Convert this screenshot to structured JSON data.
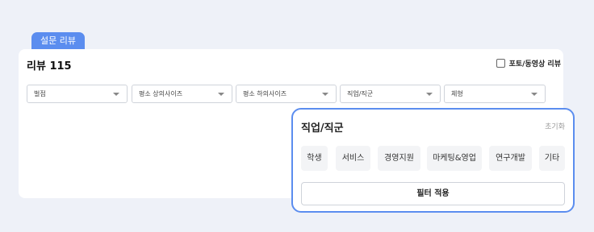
{
  "header_tab": "설문 리뷰",
  "review": {
    "title": "리뷰 115",
    "photo_video_filter": "포토/동영상 리뷰"
  },
  "dropdowns": [
    "벌점",
    "평소 상의사이즈",
    "평소 하의사이즈",
    "직업/직군",
    "체형"
  ],
  "popup": {
    "title": "직업/직군",
    "reset_label": "초기화",
    "options": [
      "학생",
      "서비스",
      "경영지원",
      "마케팅&영업",
      "연구개발",
      "기타"
    ],
    "apply_label": "필터 적용"
  },
  "colors": {
    "accent": "#5b8def",
    "background": "#eef1f8"
  }
}
